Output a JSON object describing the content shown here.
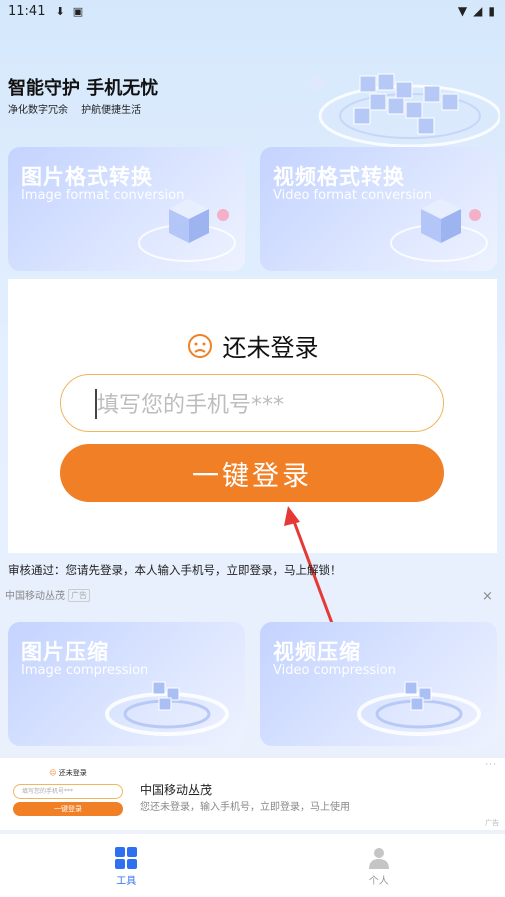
{
  "status_bar": {
    "time": "11:41"
  },
  "hero": {
    "title": "智能守护 手机无忧",
    "subtitle": "净化数字冗余　 护航便捷生活"
  },
  "cards_top": [
    {
      "title": "图片格式转换",
      "subtitle": "Image format conversion"
    },
    {
      "title": "视频格式转换",
      "subtitle": "Video format conversion"
    }
  ],
  "login": {
    "status_text": "还未登录",
    "phone_placeholder": "填写您的手机号***",
    "login_button": "一键登录"
  },
  "audit_notice": "审核通过：您请先登录，本人输入手机号，立即登录，马上解锁！",
  "ad": {
    "source": "中国移动丛茂",
    "tag": "广告",
    "close": "×"
  },
  "cards_bottom": [
    {
      "title": "图片压缩",
      "subtitle": "Image compression"
    },
    {
      "title": "视频压缩",
      "subtitle": "Video compression"
    }
  ],
  "banner_ad": {
    "mini_status": "还未登录",
    "mini_placeholder": "填写您的手机号***",
    "mini_button": "一键登录",
    "title": "中国移动丛茂",
    "description": "您还未登录，输入手机号，立即登录，马上使用",
    "menu": "···",
    "mark": "广告"
  },
  "nav": [
    {
      "label": "工具",
      "active": true,
      "icon": "grid-icon"
    },
    {
      "label": "个人",
      "active": false,
      "icon": "person-icon"
    }
  ],
  "colors": {
    "accent": "#f07f25",
    "nav_active": "#2f6ff1",
    "card_gradient_start": "#c4d3ff"
  }
}
